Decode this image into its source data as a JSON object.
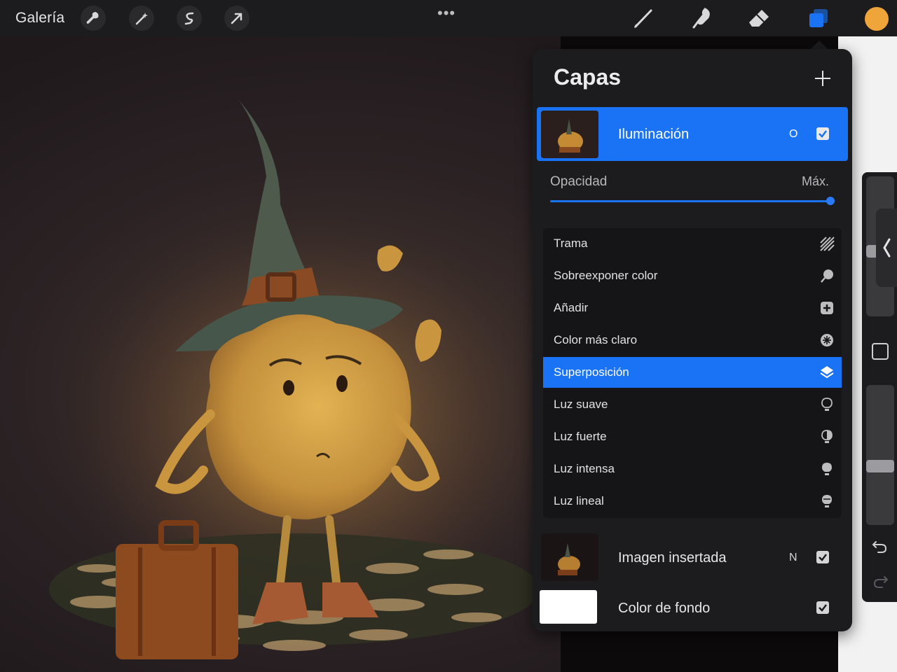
{
  "topbar": {
    "gallery_label": "Galería",
    "menu_dots": "•••",
    "tools": [
      "wrench-icon",
      "magic-wand-icon",
      "selection-icon",
      "transform-arrow-icon"
    ],
    "right_tools": [
      "brush-icon",
      "smudge-icon",
      "eraser-icon",
      "layers-icon"
    ],
    "current_color": "#f0a53a"
  },
  "layers_panel": {
    "title": "Capas",
    "add_icon": "plus-icon",
    "active_layer": {
      "name": "Iluminación",
      "blend_letter": "O",
      "visible": true
    },
    "opacity": {
      "label": "Opacidad",
      "value_label": "Máx.",
      "fraction": 1.0
    },
    "blend_modes": [
      {
        "label": "Trama",
        "icon": "hatch-icon",
        "selected": false
      },
      {
        "label": "Sobreexponer color",
        "icon": "dodge-icon",
        "selected": false
      },
      {
        "label": "Añadir",
        "icon": "add-square-icon",
        "selected": false
      },
      {
        "label": "Color más claro",
        "icon": "starburst-icon",
        "selected": false
      },
      {
        "label": "Superposición",
        "icon": "layers-stack-icon",
        "selected": true
      },
      {
        "label": "Luz suave",
        "icon": "bulb-outline-icon",
        "selected": false
      },
      {
        "label": "Luz fuerte",
        "icon": "bulb-half-icon",
        "selected": false
      },
      {
        "label": "Luz intensa",
        "icon": "bulb-filled-icon",
        "selected": false
      },
      {
        "label": "Luz lineal",
        "icon": "bulb-lines-icon",
        "selected": false
      }
    ],
    "layers": [
      {
        "name": "Imagen insertada",
        "blend_letter": "N",
        "visible": true
      },
      {
        "name": "Color de fondo",
        "blend_letter": "",
        "visible": true
      }
    ]
  },
  "accent_color": "#1a73f5"
}
